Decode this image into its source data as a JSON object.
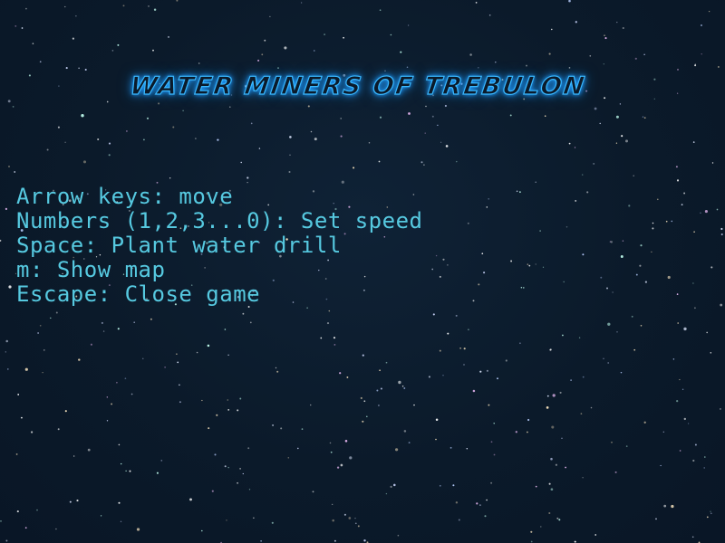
{
  "game": {
    "title": "WATER MINERS OF TREBULON",
    "colors": {
      "background": "#0b1a2a",
      "title_glow": "#1e9bff",
      "title_outline": "#39b8ff",
      "text": "#56c9e0"
    }
  },
  "controls": [
    "Arrow keys: move",
    "Numbers (1,2,3...0): Set speed",
    "Space: Plant water drill",
    "m: Show map",
    "Escape: Close game"
  ]
}
